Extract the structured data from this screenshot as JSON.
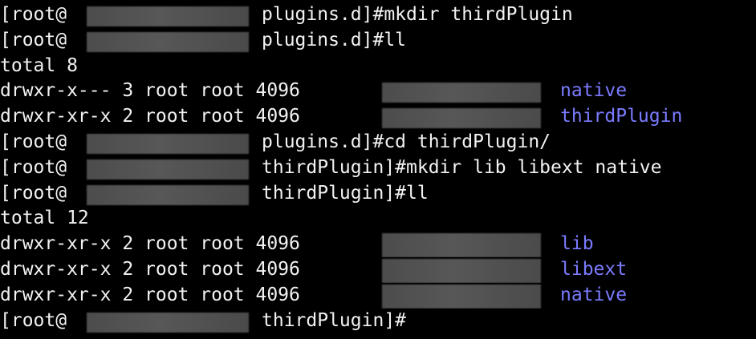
{
  "terminal": {
    "lines": [
      {
        "left": "[root@",
        "right": "plugins.d]#mkdir thirdPlugin"
      },
      {
        "left": "[root@",
        "right": "plugins.d]#ll"
      },
      {
        "text": "total 8"
      },
      {
        "left": "drwxr-x--- 3 root root 4096",
        "name": "native"
      },
      {
        "left": "drwxr-xr-x 2 root root 4096",
        "name": "thirdPlugin"
      },
      {
        "left": "[root@",
        "right": "plugins.d]#cd thirdPlugin/"
      },
      {
        "left": "[root@",
        "right": "thirdPlugin]#mkdir lib libext native"
      },
      {
        "left": "[root@",
        "right": "thirdPlugin]#ll"
      },
      {
        "text": "total 12"
      },
      {
        "left": "drwxr-xr-x 2 root root 4096",
        "name": "lib"
      },
      {
        "left": "drwxr-xr-x 2 root root 4096",
        "name": "libext"
      },
      {
        "left": "drwxr-xr-x 2 root root 4096",
        "name": "native"
      },
      {
        "left": "[root@",
        "right": "thirdPlugin]#"
      }
    ]
  },
  "colors": {
    "background": "#000000",
    "text": "#f2f2f2",
    "directory": "#7b7bff",
    "redaction": "#505050"
  }
}
